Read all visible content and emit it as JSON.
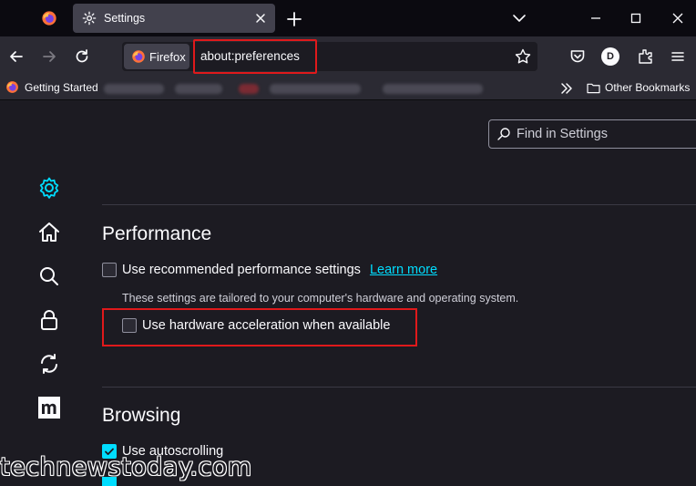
{
  "tab": {
    "title": "Settings"
  },
  "navbar": {
    "identity_label": "Firefox",
    "url": "about:preferences",
    "profile_initial": "D"
  },
  "bookmarks": {
    "getting_started": "Getting Started",
    "other": "Other Bookmarks"
  },
  "search": {
    "placeholder": "Find in Settings"
  },
  "performance": {
    "heading": "Performance",
    "recommended_label": "Use recommended performance settings",
    "recommended_checked": false,
    "learn_more": "Learn more",
    "hint": "These settings are tailored to your computer's hardware and operating system.",
    "hw_accel_label": "Use hardware acceleration when available",
    "hw_accel_checked": false
  },
  "browsing": {
    "heading": "Browsing",
    "autoscroll_label": "Use autoscrolling",
    "autoscroll_checked": true
  },
  "watermark": "technewstoday.com",
  "colors": {
    "accent": "#00ddff",
    "highlight": "#e0191b",
    "background": "#1c1b22"
  }
}
